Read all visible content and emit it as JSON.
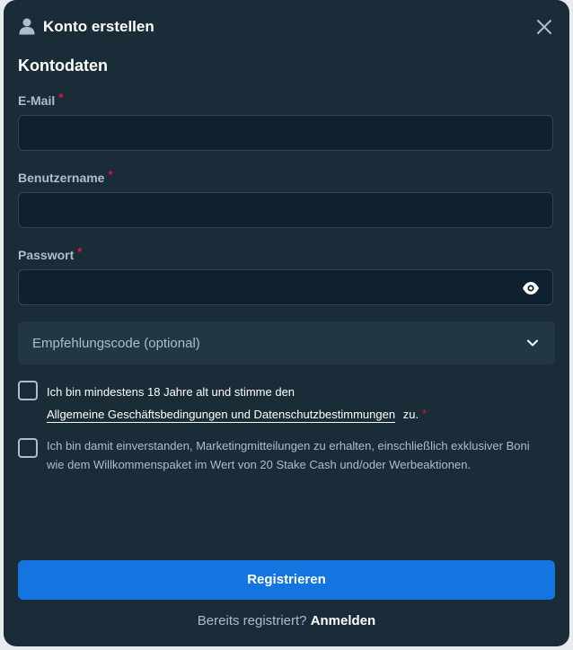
{
  "dialog": {
    "title": "Konto erstellen",
    "icons": {
      "user": "user-icon",
      "close": "close-icon",
      "eye": "eye-icon",
      "chevron": "chevron-down-icon"
    }
  },
  "form": {
    "section_title": "Kontodaten",
    "required_marker": "*",
    "email": {
      "label": "E-Mail",
      "value": ""
    },
    "username": {
      "label": "Benutzername",
      "value": ""
    },
    "password": {
      "label": "Passwort",
      "value": ""
    },
    "referral": {
      "label": "Empfehlungscode (optional)"
    }
  },
  "consents": {
    "age": {
      "checked": false,
      "line1": "Ich bin mindestens 18 Jahre alt und stimme den",
      "link": "Allgemeine Geschäftsbedingungen und Datenschutzbestimmungen",
      "suffix": "zu."
    },
    "marketing": {
      "checked": false,
      "text": "Ich bin damit einverstanden, Marketingmitteilungen zu erhalten, einschließlich exklusiver Boni wie dem Willkommenspaket im Wert von 20 Stake Cash und/oder Werbeaktionen."
    }
  },
  "actions": {
    "register_label": "Registrieren",
    "footer_text": "Bereits registriert?",
    "login_label": "Anmelden"
  },
  "colors": {
    "background": "#1a2c38",
    "input_bg": "#0f212e",
    "accent": "#1475e1",
    "required": "#e9113c",
    "muted_text": "#b1bad3"
  }
}
